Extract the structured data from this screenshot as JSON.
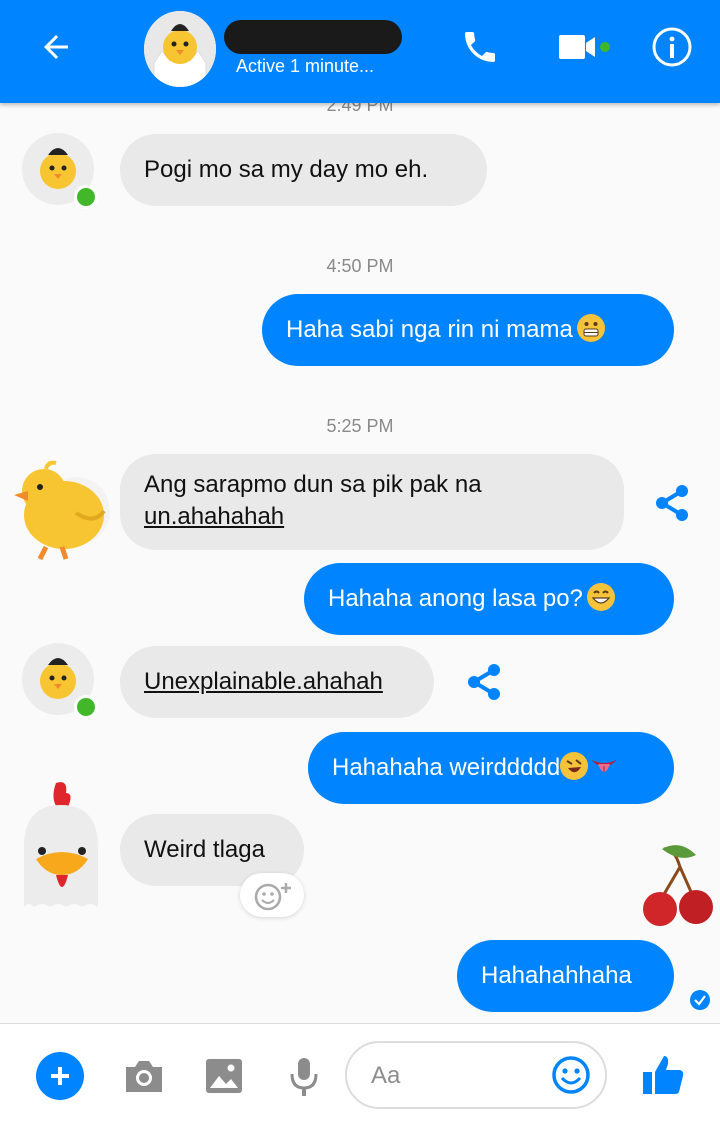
{
  "header": {
    "status": "Active 1 minute...",
    "accent": "#0084ff"
  },
  "messages": {
    "ts_partial": "2:49 PM",
    "m1": "Pogi mo sa my day mo eh.",
    "ts1": "4:50 PM",
    "m2": "Haha sabi nga rin ni mama",
    "ts2": "5:25 PM",
    "m3_line1": "Ang sarapmo dun sa pik pak na",
    "m3_line2": "un.ahahahah",
    "m4": "Hahaha anong lasa po?",
    "m5": "Unexplainable.ahahah",
    "m6": "Hahahaha weirddddd",
    "m7": "Weird tlaga",
    "m8": "Hahahahhaha"
  },
  "composer": {
    "placeholder": "Aa"
  },
  "icons": [
    "back-arrow-icon",
    "phone-icon",
    "video-icon",
    "info-icon",
    "share-icon",
    "react-icon",
    "seen-check-icon",
    "plus-icon",
    "camera-icon",
    "gallery-icon",
    "mic-icon",
    "emoji-icon",
    "like-icon"
  ]
}
